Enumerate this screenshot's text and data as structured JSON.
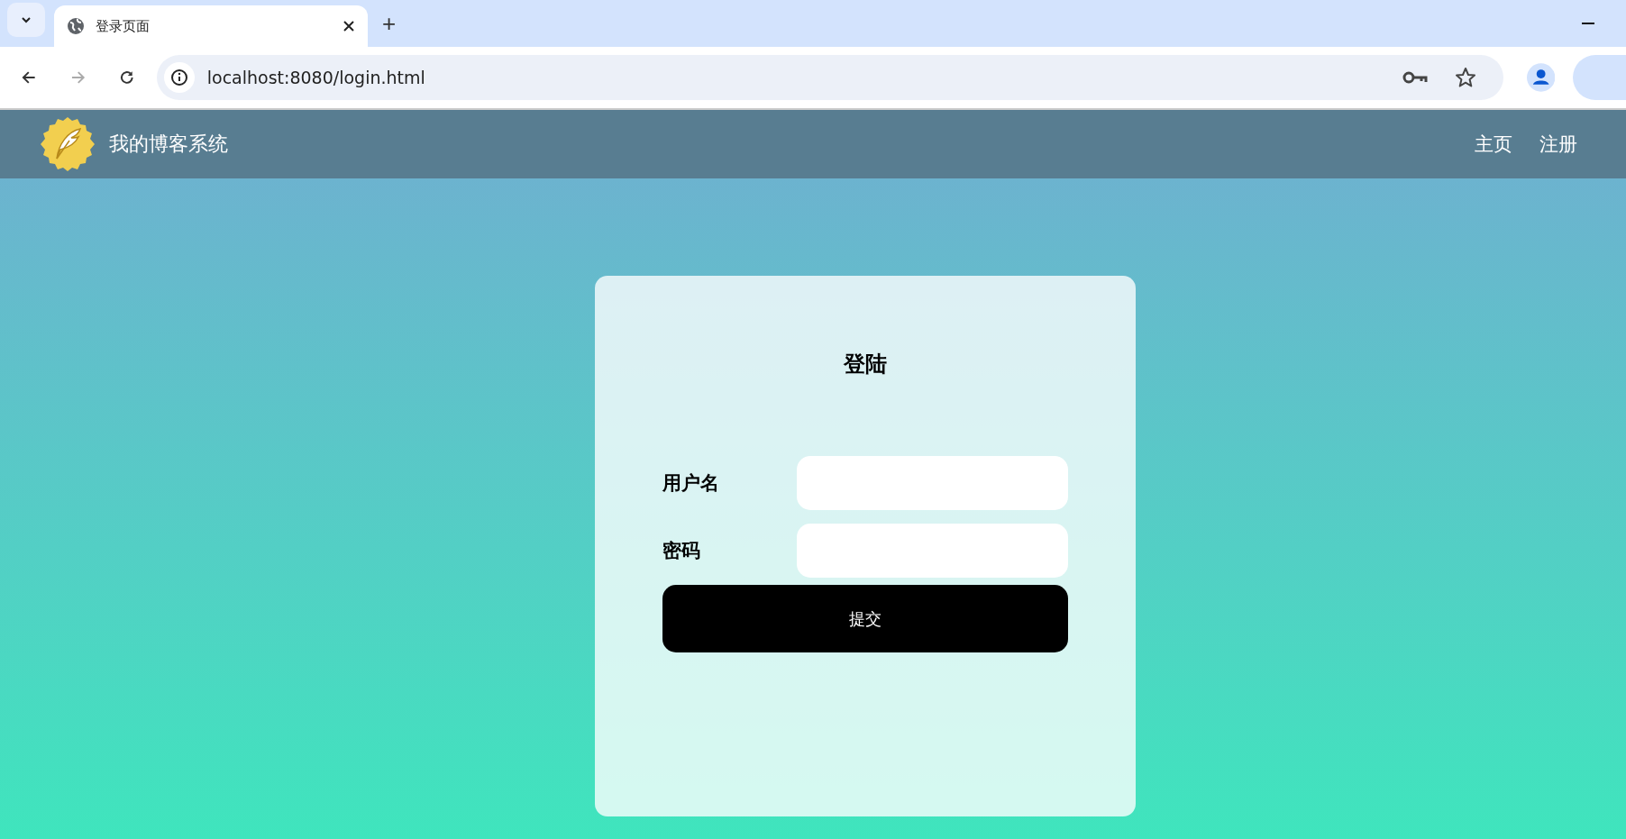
{
  "browser": {
    "tabs": [
      {
        "title": "登录页面",
        "selected": true
      }
    ],
    "new_tab": "+",
    "address": "localhost:8080/login.html"
  },
  "navbar": {
    "title": "我的博客系统",
    "links": [
      "主页",
      "注册"
    ]
  },
  "login": {
    "title": "登陆",
    "fields": [
      {
        "label": "用户名"
      },
      {
        "label": "密码"
      }
    ],
    "submit": "提交"
  }
}
